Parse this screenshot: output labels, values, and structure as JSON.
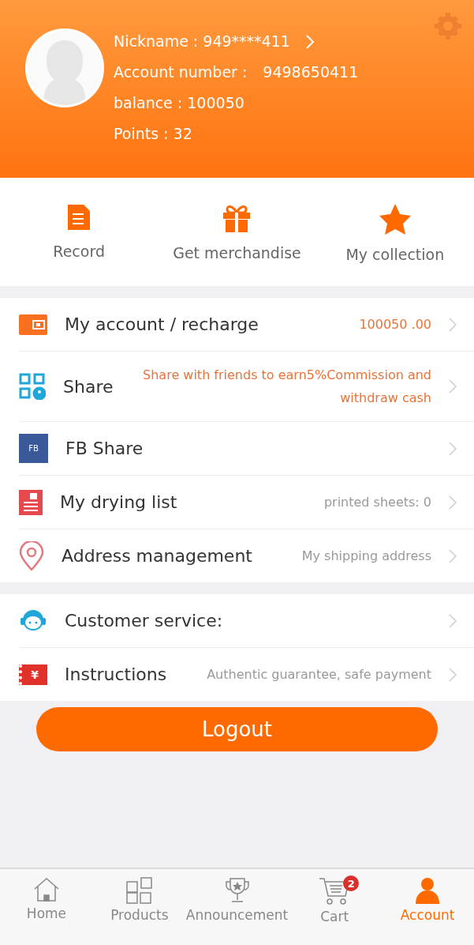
{
  "profile": {
    "nickname": "Nickname : 949****411",
    "account_label": "Account number :",
    "account_number": "9498650411",
    "balance": "balance : 100050",
    "points": "Points : 32"
  },
  "quick_actions": [
    {
      "kind": "record",
      "label": "Record"
    },
    {
      "kind": "gift",
      "label": "Get merchandise"
    },
    {
      "kind": "star",
      "label": "My collection"
    }
  ],
  "menu_groups": [
    {
      "items": [
        {
          "kind": "wallet",
          "title": "My account / recharge",
          "detail": "100050 .00",
          "color": "#e8733a"
        },
        {
          "kind": "qr",
          "title": "Share",
          "detail": "Share with friends to earn5%Commission and withdraw cash",
          "color": "#e8733a"
        },
        {
          "kind": "fb",
          "title": "FB Share",
          "badge_text": "FB"
        },
        {
          "kind": "list",
          "title": "My drying list",
          "detail": "printed sheets: 0",
          "color": "#999999"
        },
        {
          "kind": "pin",
          "title": "Address management",
          "detail": "My shipping address",
          "color": "#999999"
        }
      ]
    },
    {
      "items": [
        {
          "kind": "support",
          "title": "Customer service:"
        },
        {
          "kind": "ticket",
          "title": "Instructions",
          "detail": "Authentic guarantee, safe payment",
          "color": "#999999",
          "badge_text": "¥"
        }
      ]
    }
  ],
  "logout": "Logout",
  "tabs": [
    {
      "kind": "home",
      "label": "Home",
      "selected": false
    },
    {
      "kind": "grid",
      "label": "Products",
      "selected": false
    },
    {
      "kind": "trophy",
      "label": "Announcement",
      "selected": false
    },
    {
      "kind": "cart",
      "label": "Cart",
      "selected": false,
      "badge": "2"
    },
    {
      "kind": "user",
      "label": "Account",
      "selected": true
    }
  ]
}
